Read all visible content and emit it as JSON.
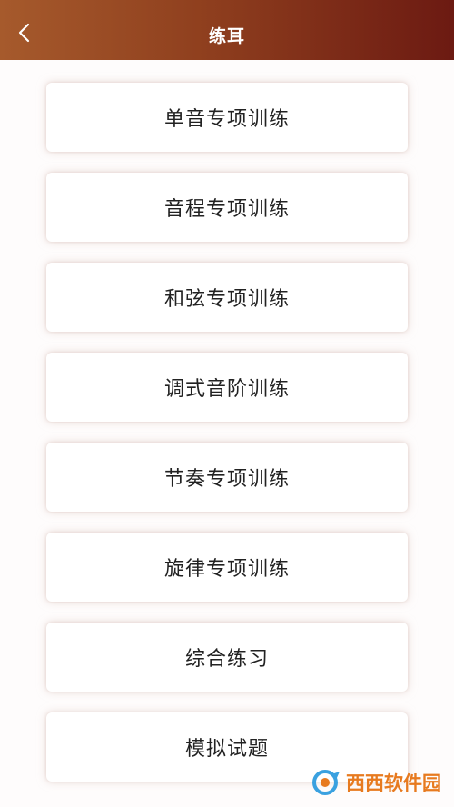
{
  "header": {
    "title": "练耳",
    "back_icon": "chevron-left-icon",
    "background_colors": [
      "#a65a2c",
      "#6c1a12"
    ]
  },
  "menu": {
    "items": [
      {
        "label": "单音专项训练"
      },
      {
        "label": "音程专项训练"
      },
      {
        "label": "和弦专项训练"
      },
      {
        "label": "调式音阶训练"
      },
      {
        "label": "节奏专项训练"
      },
      {
        "label": "旋律专项训练"
      },
      {
        "label": "综合练习"
      },
      {
        "label": "模拟试题"
      }
    ]
  },
  "watermark": {
    "text": "西西软件园",
    "icon": "site-logo-icon"
  }
}
